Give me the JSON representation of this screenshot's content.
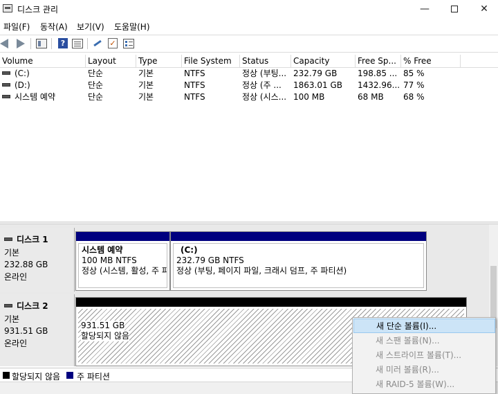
{
  "window": {
    "title": "디스크 관리",
    "minimize_glyph": "—",
    "close_glyph": "✕"
  },
  "menu": [
    "파일(F)",
    "동작(A)",
    "보기(V)",
    "도움말(H)"
  ],
  "toolbar": {
    "help_glyph": "?",
    "check_glyph": "✓",
    "icons": [
      "back-icon",
      "forward-icon",
      "console-tree-icon",
      "help-icon",
      "properties-icon",
      "rescan-key-icon",
      "check-icon",
      "list-icon"
    ]
  },
  "table": {
    "columns": [
      "Volume",
      "Layout",
      "Type",
      "File System",
      "Status",
      "Capacity",
      "Free Sp...",
      "% Free"
    ],
    "rows": [
      [
        "(C:)",
        "단순",
        "기본",
        "NTFS",
        "정상 (부팅...",
        "232.79 GB",
        "198.85 ...",
        "85 %"
      ],
      [
        "(D:)",
        "단순",
        "기본",
        "NTFS",
        "정상 (주 ...",
        "1863.01 GB",
        "1432.96...",
        "77 %"
      ],
      [
        "시스템 예약",
        "단순",
        "기본",
        "NTFS",
        "정상 (시스...",
        "100 MB",
        "68 MB",
        "68 %"
      ]
    ]
  },
  "disks": {
    "disk1": {
      "name": "디스크 1",
      "type": "기본",
      "size": "232.88 GB",
      "state": "온라인",
      "partitions": [
        {
          "name": "시스템 예약",
          "size_fs": "100 MB NTFS",
          "status": "정상 (시스템, 활성, 주 파"
        },
        {
          "name": "(C:)",
          "size_fs": "232.79 GB NTFS",
          "status": "정상 (부팅, 페이지 파일, 크래시 덤프, 주 파티션)"
        }
      ]
    },
    "disk2": {
      "name": "디스크 2",
      "type": "기본",
      "size": "931.51 GB",
      "state": "온라인",
      "unallocated": {
        "size": "931.51 GB",
        "label": "할당되지 않음"
      }
    }
  },
  "legend": [
    {
      "label": "할당되지 않음",
      "color": "#000000"
    },
    {
      "label": "주 파티션",
      "color": "#00007f"
    }
  ],
  "context_menu": [
    {
      "label": "새 단순 볼륨(I)...",
      "state": "active"
    },
    {
      "label": "새 스팬 볼륨(N)...",
      "state": "disabled"
    },
    {
      "label": "새 스트라이프 볼륨(T)...",
      "state": "disabled"
    },
    {
      "label": "새 미러 볼륨(R)...",
      "state": "disabled"
    },
    {
      "label": "새 RAID-5 볼륨(W)...",
      "state": "disabled"
    }
  ],
  "colors": {
    "primary_partition": "#00007f",
    "unallocated": "#000000",
    "menu_highlight": "#cce4f7"
  }
}
